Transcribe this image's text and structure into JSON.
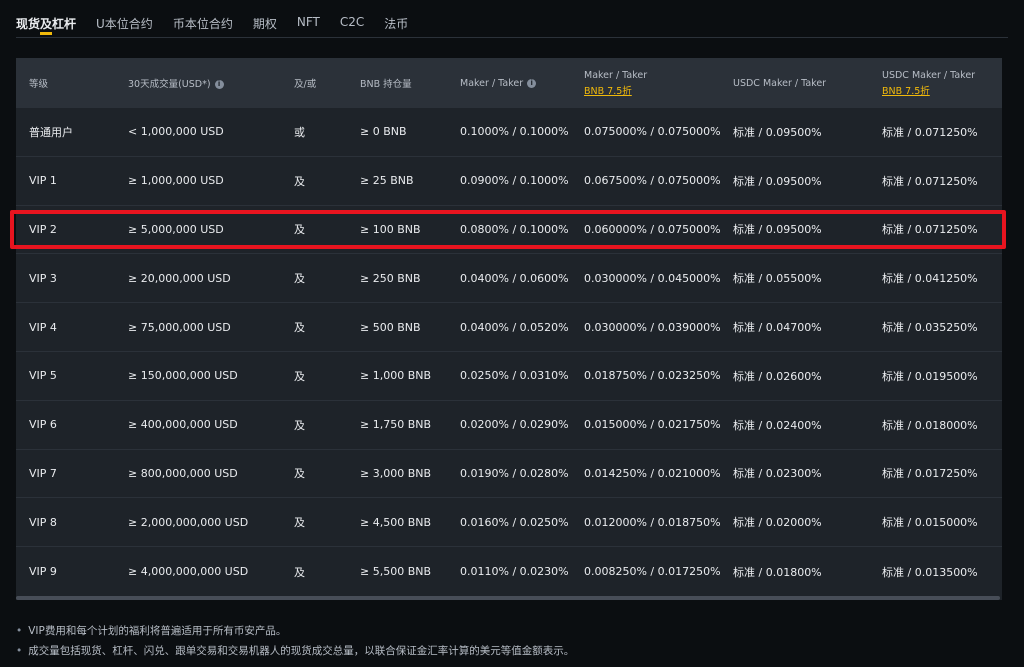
{
  "tabs": [
    {
      "label": "现货及杠杆",
      "active": true
    },
    {
      "label": "U本位合约"
    },
    {
      "label": "币本位合约"
    },
    {
      "label": "期权"
    },
    {
      "label": "NFT"
    },
    {
      "label": "C2C"
    },
    {
      "label": "法币"
    }
  ],
  "table": {
    "headers": {
      "level": "等级",
      "volume": "30天成交量(USD*)",
      "and_or": "及/或",
      "bnb_holding": "BNB 持仓量",
      "maker_taker": "Maker / Taker",
      "maker_taker_bnb": "Maker / Taker",
      "maker_taker_bnb_sub": "BNB 7.5折",
      "usdc_maker_taker": "USDC Maker / Taker",
      "usdc_maker_taker_bnb": "USDC Maker / Taker",
      "usdc_maker_taker_bnb_sub": "BNB 7.5折"
    },
    "rows": [
      [
        "普通用户",
        "< 1,000,000 USD",
        "或",
        "≥ 0 BNB",
        "0.1000% / 0.1000%",
        "0.075000% / 0.075000%",
        "标准 / 0.09500%",
        "标准 / 0.071250%"
      ],
      [
        "VIP 1",
        "≥ 1,000,000 USD",
        "及",
        "≥ 25 BNB",
        "0.0900% / 0.1000%",
        "0.067500% / 0.075000%",
        "标准 / 0.09500%",
        "标准 / 0.071250%"
      ],
      [
        "VIP 2",
        "≥ 5,000,000 USD",
        "及",
        "≥ 100 BNB",
        "0.0800% / 0.1000%",
        "0.060000% / 0.075000%",
        "标准 / 0.09500%",
        "标准 / 0.071250%"
      ],
      [
        "VIP 3",
        "≥ 20,000,000 USD",
        "及",
        "≥ 250 BNB",
        "0.0400% / 0.0600%",
        "0.030000% / 0.045000%",
        "标准 / 0.05500%",
        "标准 / 0.041250%"
      ],
      [
        "VIP 4",
        "≥ 75,000,000 USD",
        "及",
        "≥ 500 BNB",
        "0.0400% / 0.0520%",
        "0.030000% / 0.039000%",
        "标准 / 0.04700%",
        "标准 / 0.035250%"
      ],
      [
        "VIP 5",
        "≥ 150,000,000 USD",
        "及",
        "≥ 1,000 BNB",
        "0.0250% / 0.0310%",
        "0.018750% / 0.023250%",
        "标准 / 0.02600%",
        "标准 / 0.019500%"
      ],
      [
        "VIP 6",
        "≥ 400,000,000 USD",
        "及",
        "≥ 1,750 BNB",
        "0.0200% / 0.0290%",
        "0.015000% / 0.021750%",
        "标准 / 0.02400%",
        "标准 / 0.018000%"
      ],
      [
        "VIP 7",
        "≥ 800,000,000 USD",
        "及",
        "≥ 3,000 BNB",
        "0.0190% / 0.0280%",
        "0.014250% / 0.021000%",
        "标准 / 0.02300%",
        "标准 / 0.017250%"
      ],
      [
        "VIP 8",
        "≥ 2,000,000,000 USD",
        "及",
        "≥ 4,500 BNB",
        "0.0160% / 0.0250%",
        "0.012000% / 0.018750%",
        "标准 / 0.02000%",
        "标准 / 0.015000%"
      ],
      [
        "VIP 9",
        "≥ 4,000,000,000 USD",
        "及",
        "≥ 5,500 BNB",
        "0.0110% / 0.0230%",
        "0.008250% / 0.017250%",
        "标准 / 0.01800%",
        "标准 / 0.013500%"
      ]
    ]
  },
  "notes": [
    "VIP费用和每个计划的福利将普遍适用于所有币安产品。",
    "成交量包括现货、杠杆、闪兑、跟单交易和交易机器人的现货成交总量，以联合保证金汇率计算的美元等值金额表示。"
  ],
  "colors": {
    "background": "#0b0e11",
    "table_bg": "#1e2329",
    "header_bg": "#2b3139",
    "accent": "#f0b90b",
    "highlight": "#e8141f"
  },
  "icons": {
    "info": "info-icon"
  },
  "highlighted_row": 2
}
